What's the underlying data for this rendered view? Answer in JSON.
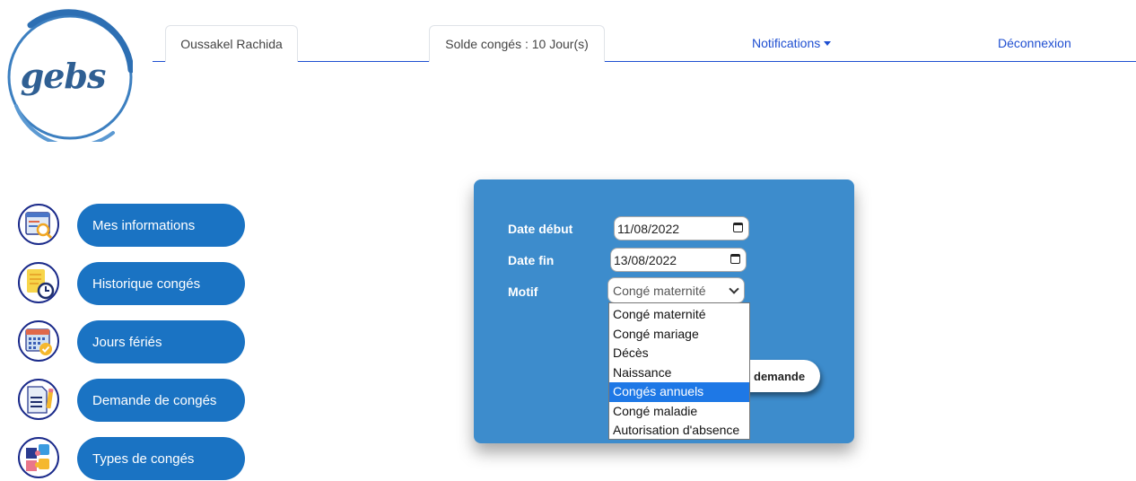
{
  "logo": {
    "text": "gebs"
  },
  "nav": {
    "user": "Oussakel Rachida",
    "balance": "Solde congés : 10 Jour(s)",
    "notifications": "Notifications",
    "logout": "Déconnexion"
  },
  "sidebar": {
    "items": [
      {
        "label": "Mes informations",
        "icon": "profile-search-icon"
      },
      {
        "label": "Historique congés",
        "icon": "history-clock-icon"
      },
      {
        "label": "Jours fériés",
        "icon": "calendar-check-icon"
      },
      {
        "label": "Demande de congés",
        "icon": "document-request-icon"
      },
      {
        "label": "Types de congés",
        "icon": "puzzle-icon"
      }
    ]
  },
  "form": {
    "start_label": "Date début",
    "start_value": "11/08/2022",
    "end_label": "Date fin",
    "end_value": "13/08/2022",
    "reason_label": "Motif",
    "reason_value": "Congé maternité",
    "submit_label": "demande",
    "options": [
      "Congé maternité",
      "Congé mariage",
      "Décès",
      "Naissance",
      "Congés annuels",
      "Congé maladie",
      "Autorisation d'absence"
    ],
    "highlighted_option": "Congés annuels"
  },
  "colors": {
    "panel": "#3d8ccc",
    "sidebar_button": "#1a73c3",
    "link": "#1f4fd1",
    "highlight": "#1e78e6"
  }
}
